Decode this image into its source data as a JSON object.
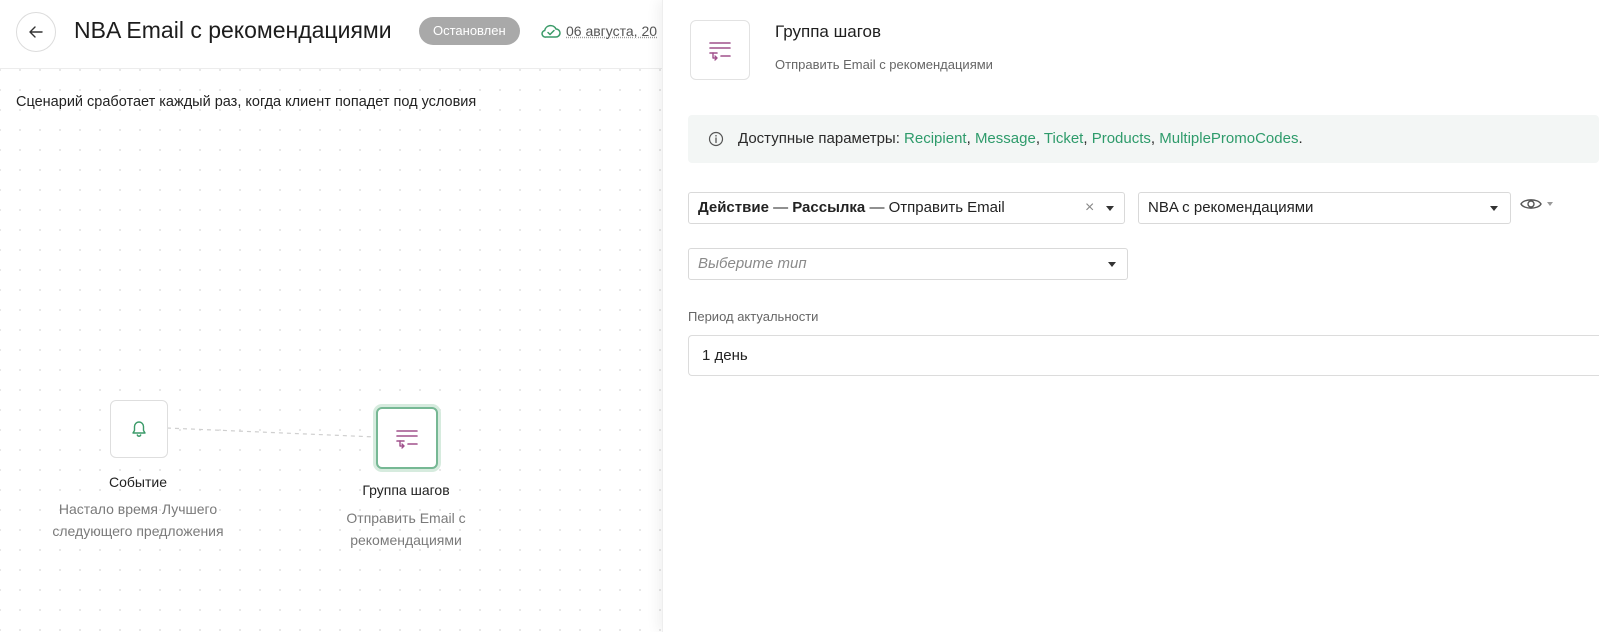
{
  "header": {
    "title": "NBA Email с рекомендациями",
    "status": "Остановлен",
    "date": "06 августа, 20"
  },
  "canvas": {
    "scenario_text": "Сценарий сработает каждый раз, когда клиент попадет под условия",
    "nodes": [
      {
        "title": "Событие",
        "subtitle": "Настало время Лучшего следующего предложения",
        "icon": "bell-icon"
      },
      {
        "title": "Группа шагов",
        "subtitle": "Отправить Email с рекомендациями",
        "icon": "step-group-icon"
      }
    ]
  },
  "panel": {
    "title": "Группа шагов",
    "subtitle": "Отправить Email с рекомендациями",
    "info": {
      "label": "Доступные параметры:",
      "params": [
        "Recipient",
        "Message",
        "Ticket",
        "Products",
        "MultiplePromoCodes"
      ]
    },
    "action_select": {
      "part1": "Действие",
      "part2": "Рассылка",
      "part3": "Отправить Email"
    },
    "template_select": {
      "value": "NBA с рекомендациями"
    },
    "type_select": {
      "placeholder": "Выберите тип"
    },
    "period": {
      "label": "Период актуальности",
      "value": "1 день"
    }
  },
  "colors": {
    "accent_green": "#2e9b6b",
    "icon_purple": "#a0508c",
    "status_gray": "#a9a9a9"
  }
}
